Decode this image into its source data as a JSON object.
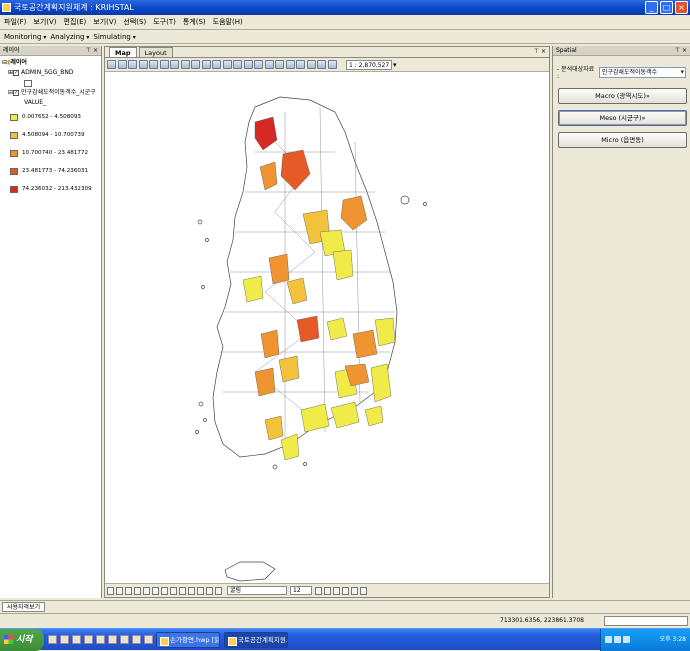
{
  "window": {
    "title": "국토공간계획지원체계 : KRIHSTAL"
  },
  "menu": [
    "파일(F)",
    "보기(V)",
    "편집(E)",
    "보기(V)",
    "선택(S)",
    "도구(T)",
    "통계(S)",
    "도움말(H)"
  ],
  "toolbar1": [
    "Monitoring",
    "Analyzing",
    "Simulating"
  ],
  "left_panel": {
    "title": "레이어",
    "root": "레이어",
    "layer1": "ADMIN_SGG_BND",
    "layer2": "인구감쇄도적이동객수_시군구",
    "value_field": "VALUE_",
    "legend": [
      {
        "label": "0.007652 - 4.508093",
        "color": "#f1eb4a"
      },
      {
        "label": "4.508094 - 10.700739",
        "color": "#f3c13a"
      },
      {
        "label": "10.700740 - 23.481772",
        "color": "#ef9430"
      },
      {
        "label": "23.481773 - 74.236031",
        "color": "#e65a25"
      },
      {
        "label": "74.236032 - 213.432309",
        "color": "#d52a24"
      }
    ]
  },
  "map": {
    "tabs": [
      "Map",
      "Layout"
    ],
    "scale": "1 : 2,870,527",
    "font_name": "굴림",
    "font_size": "12"
  },
  "right_panel": {
    "title": "Spatial",
    "select_label": "- 분석대상자료 :",
    "select_value": "인구감쇄도적이동객수",
    "buttons": [
      "Macro (광역시도)»",
      "Meso (시군구)»",
      "Micro (읍면동)"
    ]
  },
  "bottom_tab": "사용자격보기",
  "status": {
    "coords": "713301.6356, 223861.3708"
  },
  "taskbar": {
    "start": "시작",
    "tasks": [
      "손가항면.hwp [읽...",
      "국토공간계획지원..."
    ],
    "clock": "오후 3:28"
  }
}
